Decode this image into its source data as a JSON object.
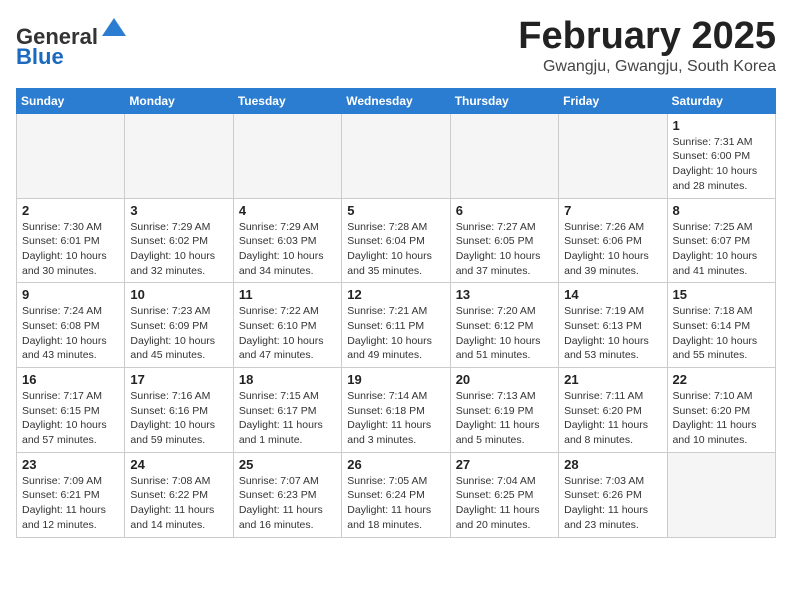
{
  "header": {
    "logo_general": "General",
    "logo_blue": "Blue",
    "month_title": "February 2025",
    "location": "Gwangju, Gwangju, South Korea"
  },
  "days_of_week": [
    "Sunday",
    "Monday",
    "Tuesday",
    "Wednesday",
    "Thursday",
    "Friday",
    "Saturday"
  ],
  "weeks": [
    [
      {
        "day": "",
        "info": ""
      },
      {
        "day": "",
        "info": ""
      },
      {
        "day": "",
        "info": ""
      },
      {
        "day": "",
        "info": ""
      },
      {
        "day": "",
        "info": ""
      },
      {
        "day": "",
        "info": ""
      },
      {
        "day": "1",
        "info": "Sunrise: 7:31 AM\nSunset: 6:00 PM\nDaylight: 10 hours and 28 minutes."
      }
    ],
    [
      {
        "day": "2",
        "info": "Sunrise: 7:30 AM\nSunset: 6:01 PM\nDaylight: 10 hours and 30 minutes."
      },
      {
        "day": "3",
        "info": "Sunrise: 7:29 AM\nSunset: 6:02 PM\nDaylight: 10 hours and 32 minutes."
      },
      {
        "day": "4",
        "info": "Sunrise: 7:29 AM\nSunset: 6:03 PM\nDaylight: 10 hours and 34 minutes."
      },
      {
        "day": "5",
        "info": "Sunrise: 7:28 AM\nSunset: 6:04 PM\nDaylight: 10 hours and 35 minutes."
      },
      {
        "day": "6",
        "info": "Sunrise: 7:27 AM\nSunset: 6:05 PM\nDaylight: 10 hours and 37 minutes."
      },
      {
        "day": "7",
        "info": "Sunrise: 7:26 AM\nSunset: 6:06 PM\nDaylight: 10 hours and 39 minutes."
      },
      {
        "day": "8",
        "info": "Sunrise: 7:25 AM\nSunset: 6:07 PM\nDaylight: 10 hours and 41 minutes."
      }
    ],
    [
      {
        "day": "9",
        "info": "Sunrise: 7:24 AM\nSunset: 6:08 PM\nDaylight: 10 hours and 43 minutes."
      },
      {
        "day": "10",
        "info": "Sunrise: 7:23 AM\nSunset: 6:09 PM\nDaylight: 10 hours and 45 minutes."
      },
      {
        "day": "11",
        "info": "Sunrise: 7:22 AM\nSunset: 6:10 PM\nDaylight: 10 hours and 47 minutes."
      },
      {
        "day": "12",
        "info": "Sunrise: 7:21 AM\nSunset: 6:11 PM\nDaylight: 10 hours and 49 minutes."
      },
      {
        "day": "13",
        "info": "Sunrise: 7:20 AM\nSunset: 6:12 PM\nDaylight: 10 hours and 51 minutes."
      },
      {
        "day": "14",
        "info": "Sunrise: 7:19 AM\nSunset: 6:13 PM\nDaylight: 10 hours and 53 minutes."
      },
      {
        "day": "15",
        "info": "Sunrise: 7:18 AM\nSunset: 6:14 PM\nDaylight: 10 hours and 55 minutes."
      }
    ],
    [
      {
        "day": "16",
        "info": "Sunrise: 7:17 AM\nSunset: 6:15 PM\nDaylight: 10 hours and 57 minutes."
      },
      {
        "day": "17",
        "info": "Sunrise: 7:16 AM\nSunset: 6:16 PM\nDaylight: 10 hours and 59 minutes."
      },
      {
        "day": "18",
        "info": "Sunrise: 7:15 AM\nSunset: 6:17 PM\nDaylight: 11 hours and 1 minute."
      },
      {
        "day": "19",
        "info": "Sunrise: 7:14 AM\nSunset: 6:18 PM\nDaylight: 11 hours and 3 minutes."
      },
      {
        "day": "20",
        "info": "Sunrise: 7:13 AM\nSunset: 6:19 PM\nDaylight: 11 hours and 5 minutes."
      },
      {
        "day": "21",
        "info": "Sunrise: 7:11 AM\nSunset: 6:20 PM\nDaylight: 11 hours and 8 minutes."
      },
      {
        "day": "22",
        "info": "Sunrise: 7:10 AM\nSunset: 6:20 PM\nDaylight: 11 hours and 10 minutes."
      }
    ],
    [
      {
        "day": "23",
        "info": "Sunrise: 7:09 AM\nSunset: 6:21 PM\nDaylight: 11 hours and 12 minutes."
      },
      {
        "day": "24",
        "info": "Sunrise: 7:08 AM\nSunset: 6:22 PM\nDaylight: 11 hours and 14 minutes."
      },
      {
        "day": "25",
        "info": "Sunrise: 7:07 AM\nSunset: 6:23 PM\nDaylight: 11 hours and 16 minutes."
      },
      {
        "day": "26",
        "info": "Sunrise: 7:05 AM\nSunset: 6:24 PM\nDaylight: 11 hours and 18 minutes."
      },
      {
        "day": "27",
        "info": "Sunrise: 7:04 AM\nSunset: 6:25 PM\nDaylight: 11 hours and 20 minutes."
      },
      {
        "day": "28",
        "info": "Sunrise: 7:03 AM\nSunset: 6:26 PM\nDaylight: 11 hours and 23 minutes."
      },
      {
        "day": "",
        "info": ""
      }
    ]
  ]
}
